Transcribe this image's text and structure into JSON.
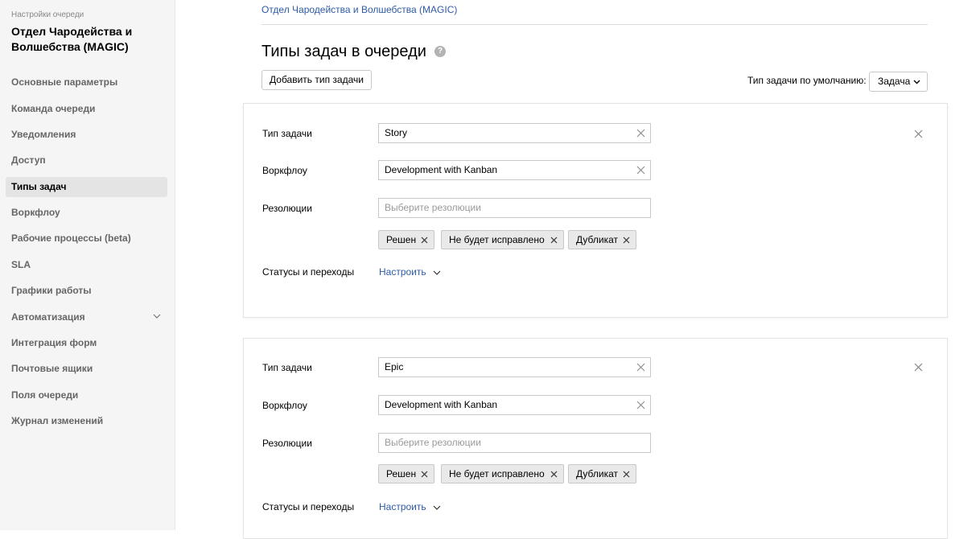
{
  "sidebar": {
    "caption": "Настройки очереди",
    "title": "Отдел Чародейства и Волшебства (MAGIC)",
    "items": [
      {
        "label": "Основные параметры"
      },
      {
        "label": "Команда очереди"
      },
      {
        "label": "Уведомления"
      },
      {
        "label": "Доступ"
      },
      {
        "label": "Типы задач",
        "active": true
      },
      {
        "label": "Воркфлоу"
      },
      {
        "label": "Рабочие процессы (beta)"
      },
      {
        "label": "SLA"
      },
      {
        "label": "Графики работы"
      },
      {
        "label": "Автоматизация",
        "expandable": true,
        "icon": "chevron-down-icon"
      },
      {
        "label": "Интеграция форм"
      },
      {
        "label": "Почтовые ящики"
      },
      {
        "label": "Поля очереди"
      },
      {
        "label": "Журнал изменений"
      }
    ]
  },
  "breadcrumb": "Отдел Чародейства и Волшебства (MAGIC)",
  "page_title": "Типы задач в очереди",
  "help_icon": "?",
  "add_button": "Добавить тип задачи",
  "default_type": {
    "label": "Тип задачи по умолчанию:",
    "value": "Задача"
  },
  "labels": {
    "type": "Тип задачи",
    "workflow": "Воркфлоу",
    "resolutions": "Резолюции",
    "statuses": "Статусы и переходы",
    "configure": "Настроить",
    "resolutions_placeholder": "Выберите резолюции"
  },
  "cards": [
    {
      "type": "Story",
      "workflow": "Development with Kanban",
      "resolutions": [
        "Решен",
        "Не будет исправлено",
        "Дубликат"
      ]
    },
    {
      "type": "Epic",
      "workflow": "Development with Kanban",
      "resolutions": [
        "Решен",
        "Не будет исправлено",
        "Дубликат"
      ]
    }
  ],
  "colors": {
    "link": "#2d5aa6",
    "sidebar_bg": "#f5f5f5",
    "active_item_bg": "#e4e4e4",
    "tag_bg": "#e9e9e9"
  }
}
